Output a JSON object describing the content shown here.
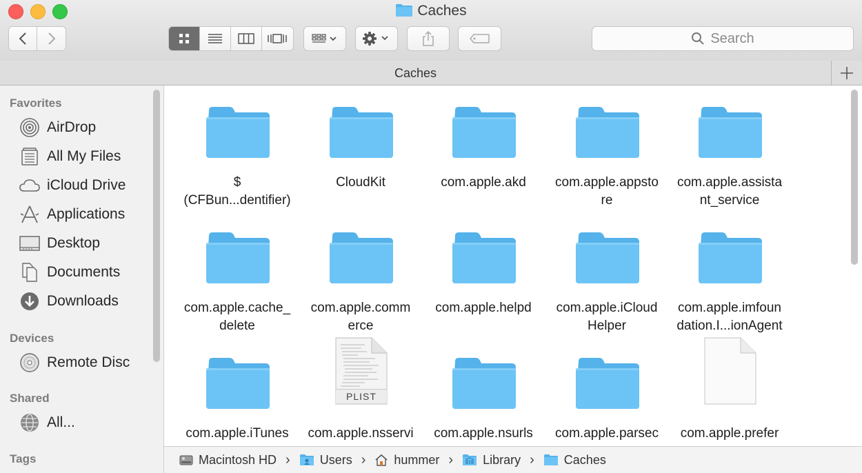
{
  "window": {
    "title": "Caches"
  },
  "toolbar": {
    "search_placeholder": "Search"
  },
  "path_header": {
    "title": "Caches"
  },
  "sidebar": {
    "sections": [
      {
        "label": "Favorites"
      },
      {
        "label": "Devices"
      },
      {
        "label": "Shared"
      },
      {
        "label": "Tags"
      }
    ],
    "favorites": [
      {
        "label": "AirDrop",
        "icon": "airdrop-icon"
      },
      {
        "label": "All My Files",
        "icon": "all-my-files-icon"
      },
      {
        "label": "iCloud Drive",
        "icon": "cloud-icon"
      },
      {
        "label": "Applications",
        "icon": "applications-icon"
      },
      {
        "label": "Desktop",
        "icon": "desktop-icon"
      },
      {
        "label": "Documents",
        "icon": "documents-icon"
      },
      {
        "label": "Downloads",
        "icon": "downloads-icon"
      }
    ],
    "devices": [
      {
        "label": "Remote Disc",
        "icon": "disc-icon"
      }
    ],
    "shared": [
      {
        "label": "All...",
        "icon": "network-icon"
      }
    ]
  },
  "files": [
    {
      "name": "$\n(CFBun...dentifier)",
      "kind": "folder"
    },
    {
      "name": "CloudKit",
      "kind": "folder"
    },
    {
      "name": "com.apple.akd",
      "kind": "folder"
    },
    {
      "name": "com.apple.appsto\nre",
      "kind": "folder"
    },
    {
      "name": "com.apple.assista\nnt_service",
      "kind": "folder"
    },
    {
      "name": "com.apple.cache_\ndelete",
      "kind": "folder"
    },
    {
      "name": "com.apple.comm\nerce",
      "kind": "folder"
    },
    {
      "name": "com.apple.helpd",
      "kind": "folder"
    },
    {
      "name": "com.apple.iCloud\nHelper",
      "kind": "folder"
    },
    {
      "name": "com.apple.imfoun\ndation.I...ionAgent",
      "kind": "folder"
    },
    {
      "name": "com.apple.iTunes",
      "kind": "folder"
    },
    {
      "name": "com.apple.nsservi",
      "kind": "plist",
      "badge": "PLIST"
    },
    {
      "name": "com.apple.nsurls",
      "kind": "folder"
    },
    {
      "name": "com.apple.parsec",
      "kind": "folder"
    },
    {
      "name": "com.apple.prefer",
      "kind": "document"
    }
  ],
  "pathbar": [
    {
      "label": "Macintosh HD",
      "icon": "hard-drive-icon"
    },
    {
      "label": "Users",
      "icon": "users-folder-icon"
    },
    {
      "label": "hummer",
      "icon": "home-icon"
    },
    {
      "label": "Library",
      "icon": "library-folder-icon"
    },
    {
      "label": "Caches",
      "icon": "folder-icon"
    }
  ],
  "colors": {
    "folder": "#6cc3f5",
    "folder_tab": "#55b2ea",
    "selected_view": "#6e6e6e"
  }
}
